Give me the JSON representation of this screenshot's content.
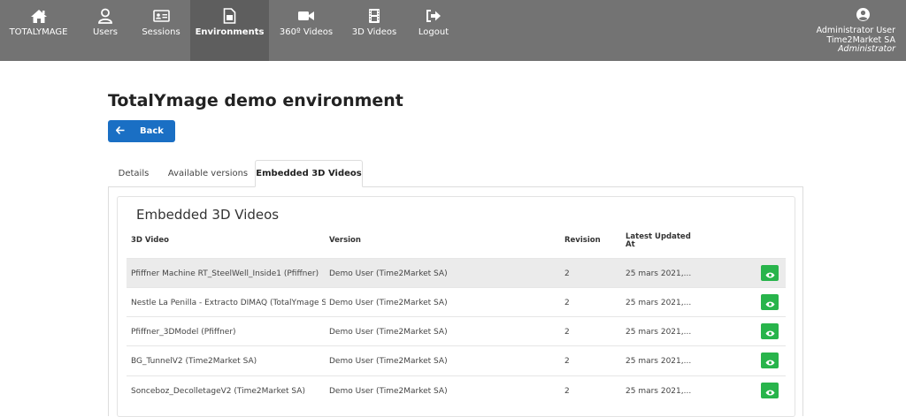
{
  "nav": {
    "items": [
      {
        "label": "TOTALYMAGE",
        "icon": "home-icon"
      },
      {
        "label": "Users",
        "icon": "user-icon"
      },
      {
        "label": "Sessions",
        "icon": "id-card-icon"
      },
      {
        "label": "Environments",
        "icon": "file-icon"
      },
      {
        "label": "360º Videos",
        "icon": "video-camera-icon"
      },
      {
        "label": "3D Videos",
        "icon": "film-icon"
      },
      {
        "label": "Logout",
        "icon": "logout-icon"
      }
    ],
    "active": "Environments",
    "user": {
      "name": "Administrator User",
      "company": "Time2Market SA",
      "role": "Administrator"
    }
  },
  "page": {
    "title": "TotalYmage demo environment",
    "back_label": "Back"
  },
  "tabs": [
    "Details",
    "Available versions",
    "Embedded 3D Videos"
  ],
  "active_tab": "Embedded 3D Videos",
  "table": {
    "title": "Embedded 3D Videos",
    "headers": {
      "video": "3D Video",
      "version": "Version",
      "revision": "Revision",
      "updated_line1": "Latest Updated",
      "updated_line2": "At"
    },
    "rows": [
      {
        "video": "Pfiffner Machine RT_SteelWell_Inside1 (Pfiffner)",
        "version": "Demo User (Time2Market SA)",
        "revision": "2",
        "updated": "25 mars 2021,..."
      },
      {
        "video": "Nestle La Penilla - Extracto DIMAQ (TotalYmage Ser...",
        "version": "Demo User (Time2Market SA)",
        "revision": "2",
        "updated": "25 mars 2021,..."
      },
      {
        "video": "Pfiffner_3DModel (Pfiffner)",
        "version": "Demo User (Time2Market SA)",
        "revision": "2",
        "updated": "25 mars 2021,..."
      },
      {
        "video": "BG_TunnelV2 (Time2Market SA)",
        "version": "Demo User (Time2Market SA)",
        "revision": "2",
        "updated": "25 mars 2021,..."
      },
      {
        "video": "Sonceboz_DecolletageV2 (Time2Market SA)",
        "version": "Demo User (Time2Market SA)",
        "revision": "2",
        "updated": "25 mars 2021,..."
      }
    ]
  },
  "colors": {
    "nav_bg": "#737373",
    "nav_active": "#5e5e5e",
    "primary": "#1a6fc4",
    "view_button": "#28b44b",
    "row_shade": "#ebebeb"
  }
}
